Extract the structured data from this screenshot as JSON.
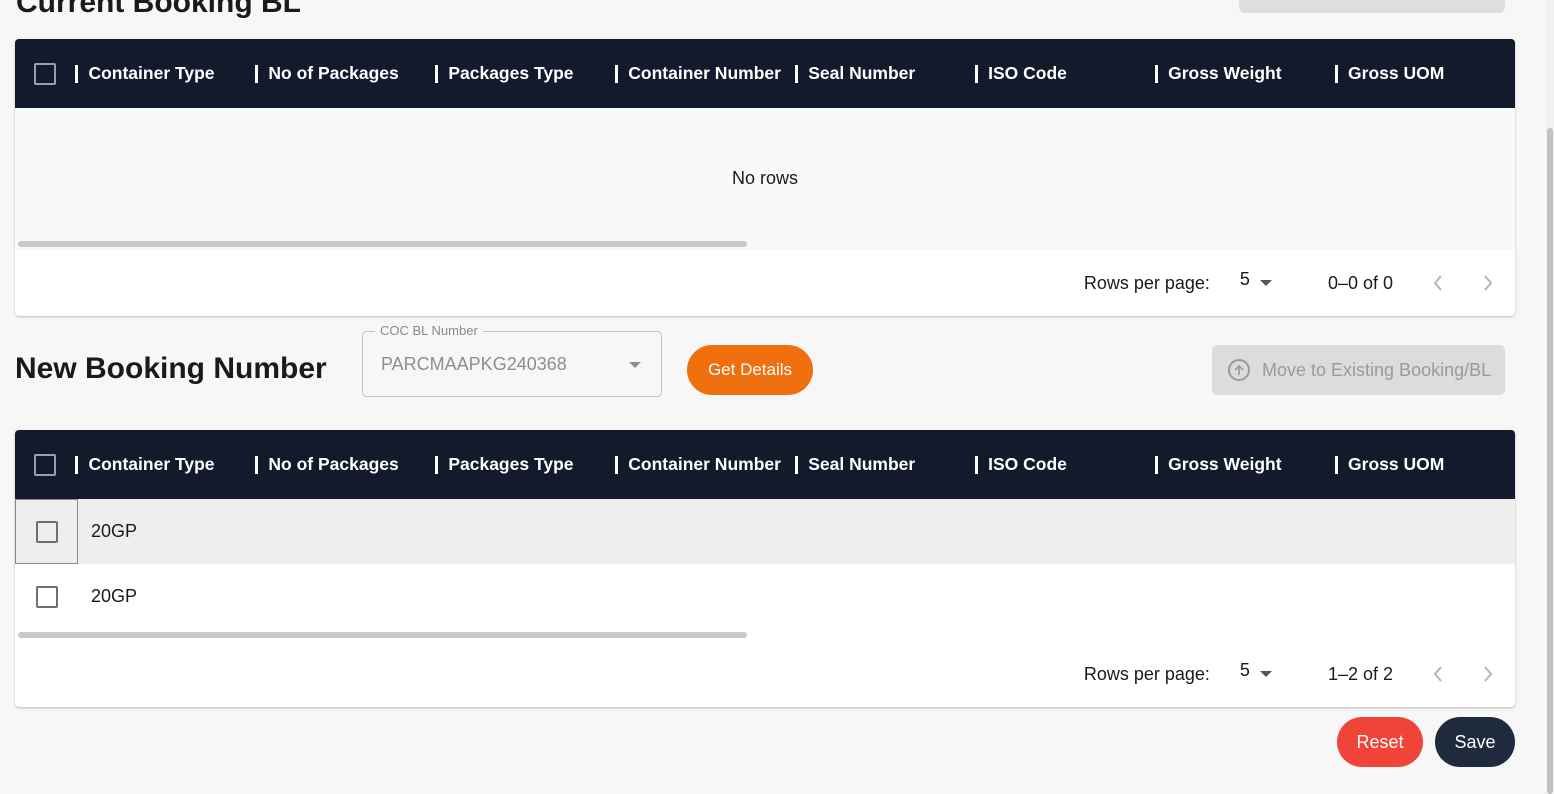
{
  "top_section": {
    "title": "Current Booking BL"
  },
  "columns": [
    "Container Type",
    "No of Packages",
    "Packages Type",
    "Container Number",
    "Seal Number",
    "ISO Code",
    "Gross Weight",
    "Gross UOM"
  ],
  "current_grid": {
    "empty_message": "No rows",
    "rows_per_page_label": "Rows per page:",
    "rows_per_page": "5",
    "range": "0–0 of 0"
  },
  "new_section": {
    "title": "New Booking Number",
    "coc_label": "COC BL Number",
    "coc_value": "PARCMAAPKG240368",
    "get_details": "Get Details",
    "move_button": "Move to Existing Booking/BL"
  },
  "new_grid": {
    "rows": [
      {
        "container_type": "20GP",
        "selected_focus": true
      },
      {
        "container_type": "20GP",
        "selected_focus": false
      }
    ],
    "rows_per_page_label": "Rows per page:",
    "rows_per_page": "5",
    "range": "1–2 of 2"
  },
  "actions": {
    "reset": "Reset",
    "save": "Save"
  },
  "colors": {
    "header_bg": "#131a2b",
    "accent_orange": "#f07010",
    "reset_red": "#f04438",
    "save_navy": "#1f2a3c"
  }
}
